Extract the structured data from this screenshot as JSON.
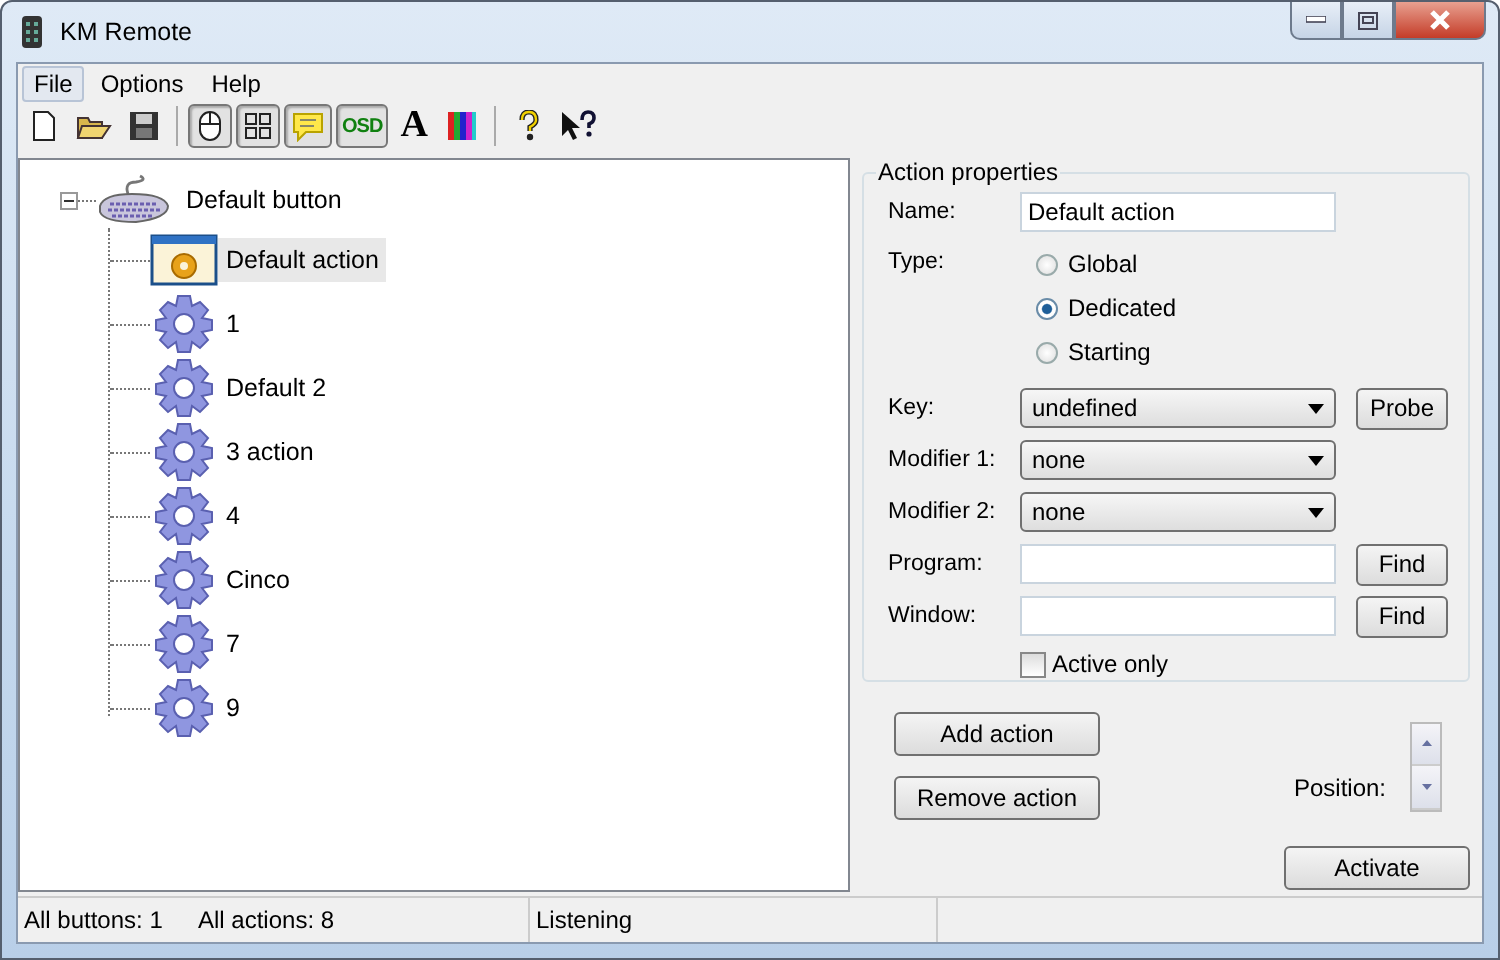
{
  "window": {
    "title": "KM Remote"
  },
  "menu": [
    {
      "label": "File",
      "selected": true
    },
    {
      "label": "Options",
      "selected": false
    },
    {
      "label": "Help",
      "selected": false
    }
  ],
  "toolbar": [
    {
      "kind": "new",
      "pressed": false
    },
    {
      "kind": "open",
      "pressed": false
    },
    {
      "kind": "save",
      "pressed": false
    },
    {
      "kind": "sep"
    },
    {
      "kind": "mouse",
      "pressed": true
    },
    {
      "kind": "grid",
      "pressed": true
    },
    {
      "kind": "note",
      "pressed": true
    },
    {
      "kind": "text",
      "label": "OSD",
      "pressed": true
    },
    {
      "kind": "font",
      "label": "A",
      "pressed": false
    },
    {
      "kind": "colors",
      "pressed": false
    },
    {
      "kind": "sep"
    },
    {
      "kind": "help",
      "pressed": false
    },
    {
      "kind": "whatsthis",
      "pressed": false
    }
  ],
  "tree": {
    "label": "Default button",
    "expanded": true,
    "children": [
      {
        "label": "Default action",
        "kind": "default",
        "selected": true
      },
      {
        "label": "1",
        "kind": "action",
        "selected": false
      },
      {
        "label": "Default 2",
        "kind": "action",
        "selected": false
      },
      {
        "label": "3 action",
        "kind": "action",
        "selected": false
      },
      {
        "label": "4",
        "kind": "action",
        "selected": false
      },
      {
        "label": "Cinco",
        "kind": "action",
        "selected": false
      },
      {
        "label": "7",
        "kind": "action",
        "selected": false
      },
      {
        "label": "9",
        "kind": "action",
        "selected": false
      }
    ]
  },
  "properties": {
    "title": "Action properties",
    "name": {
      "label": "Name:",
      "value": "Default action"
    },
    "type": {
      "label": "Type:",
      "options": [
        {
          "label": "Global",
          "selected": false
        },
        {
          "label": "Dedicated",
          "selected": true
        },
        {
          "label": "Starting",
          "selected": false
        }
      ]
    },
    "key": {
      "label": "Key:",
      "value": "undefined",
      "button": "Probe"
    },
    "modifier_1": {
      "label": "Modifier 1:",
      "value": "none"
    },
    "modifier_2": {
      "label": "Modifier 2:",
      "value": "none"
    },
    "program": {
      "label": "Program:",
      "button": "Find"
    },
    "window": {
      "label": "Window:",
      "button": "Find"
    },
    "active_only": {
      "label": "Active only",
      "checked": false
    }
  },
  "buttons": {
    "add": "Add action",
    "remove": "Remove action",
    "position": "Position:",
    "activate": "Activate"
  },
  "status_bar": [
    "All buttons: 1",
    "All actions: 8",
    "Listening"
  ]
}
